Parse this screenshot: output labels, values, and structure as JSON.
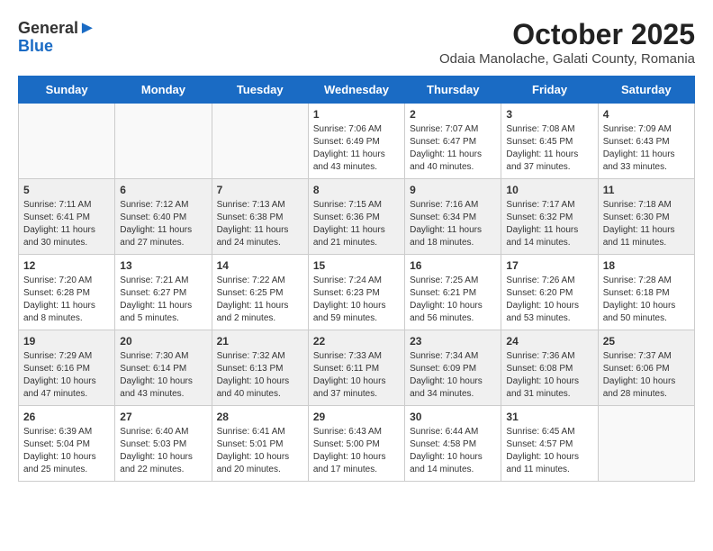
{
  "header": {
    "logo_line1": "General",
    "logo_line2": "Blue",
    "month_title": "October 2025",
    "location": "Odaia Manolache, Galati County, Romania"
  },
  "weekdays": [
    "Sunday",
    "Monday",
    "Tuesday",
    "Wednesday",
    "Thursday",
    "Friday",
    "Saturday"
  ],
  "weeks": [
    [
      {
        "day": "",
        "content": ""
      },
      {
        "day": "",
        "content": ""
      },
      {
        "day": "",
        "content": ""
      },
      {
        "day": "1",
        "content": "Sunrise: 7:06 AM\nSunset: 6:49 PM\nDaylight: 11 hours\nand 43 minutes."
      },
      {
        "day": "2",
        "content": "Sunrise: 7:07 AM\nSunset: 6:47 PM\nDaylight: 11 hours\nand 40 minutes."
      },
      {
        "day": "3",
        "content": "Sunrise: 7:08 AM\nSunset: 6:45 PM\nDaylight: 11 hours\nand 37 minutes."
      },
      {
        "day": "4",
        "content": "Sunrise: 7:09 AM\nSunset: 6:43 PM\nDaylight: 11 hours\nand 33 minutes."
      }
    ],
    [
      {
        "day": "5",
        "content": "Sunrise: 7:11 AM\nSunset: 6:41 PM\nDaylight: 11 hours\nand 30 minutes."
      },
      {
        "day": "6",
        "content": "Sunrise: 7:12 AM\nSunset: 6:40 PM\nDaylight: 11 hours\nand 27 minutes."
      },
      {
        "day": "7",
        "content": "Sunrise: 7:13 AM\nSunset: 6:38 PM\nDaylight: 11 hours\nand 24 minutes."
      },
      {
        "day": "8",
        "content": "Sunrise: 7:15 AM\nSunset: 6:36 PM\nDaylight: 11 hours\nand 21 minutes."
      },
      {
        "day": "9",
        "content": "Sunrise: 7:16 AM\nSunset: 6:34 PM\nDaylight: 11 hours\nand 18 minutes."
      },
      {
        "day": "10",
        "content": "Sunrise: 7:17 AM\nSunset: 6:32 PM\nDaylight: 11 hours\nand 14 minutes."
      },
      {
        "day": "11",
        "content": "Sunrise: 7:18 AM\nSunset: 6:30 PM\nDaylight: 11 hours\nand 11 minutes."
      }
    ],
    [
      {
        "day": "12",
        "content": "Sunrise: 7:20 AM\nSunset: 6:28 PM\nDaylight: 11 hours\nand 8 minutes."
      },
      {
        "day": "13",
        "content": "Sunrise: 7:21 AM\nSunset: 6:27 PM\nDaylight: 11 hours\nand 5 minutes."
      },
      {
        "day": "14",
        "content": "Sunrise: 7:22 AM\nSunset: 6:25 PM\nDaylight: 11 hours\nand 2 minutes."
      },
      {
        "day": "15",
        "content": "Sunrise: 7:24 AM\nSunset: 6:23 PM\nDaylight: 10 hours\nand 59 minutes."
      },
      {
        "day": "16",
        "content": "Sunrise: 7:25 AM\nSunset: 6:21 PM\nDaylight: 10 hours\nand 56 minutes."
      },
      {
        "day": "17",
        "content": "Sunrise: 7:26 AM\nSunset: 6:20 PM\nDaylight: 10 hours\nand 53 minutes."
      },
      {
        "day": "18",
        "content": "Sunrise: 7:28 AM\nSunset: 6:18 PM\nDaylight: 10 hours\nand 50 minutes."
      }
    ],
    [
      {
        "day": "19",
        "content": "Sunrise: 7:29 AM\nSunset: 6:16 PM\nDaylight: 10 hours\nand 47 minutes."
      },
      {
        "day": "20",
        "content": "Sunrise: 7:30 AM\nSunset: 6:14 PM\nDaylight: 10 hours\nand 43 minutes."
      },
      {
        "day": "21",
        "content": "Sunrise: 7:32 AM\nSunset: 6:13 PM\nDaylight: 10 hours\nand 40 minutes."
      },
      {
        "day": "22",
        "content": "Sunrise: 7:33 AM\nSunset: 6:11 PM\nDaylight: 10 hours\nand 37 minutes."
      },
      {
        "day": "23",
        "content": "Sunrise: 7:34 AM\nSunset: 6:09 PM\nDaylight: 10 hours\nand 34 minutes."
      },
      {
        "day": "24",
        "content": "Sunrise: 7:36 AM\nSunset: 6:08 PM\nDaylight: 10 hours\nand 31 minutes."
      },
      {
        "day": "25",
        "content": "Sunrise: 7:37 AM\nSunset: 6:06 PM\nDaylight: 10 hours\nand 28 minutes."
      }
    ],
    [
      {
        "day": "26",
        "content": "Sunrise: 6:39 AM\nSunset: 5:04 PM\nDaylight: 10 hours\nand 25 minutes."
      },
      {
        "day": "27",
        "content": "Sunrise: 6:40 AM\nSunset: 5:03 PM\nDaylight: 10 hours\nand 22 minutes."
      },
      {
        "day": "28",
        "content": "Sunrise: 6:41 AM\nSunset: 5:01 PM\nDaylight: 10 hours\nand 20 minutes."
      },
      {
        "day": "29",
        "content": "Sunrise: 6:43 AM\nSunset: 5:00 PM\nDaylight: 10 hours\nand 17 minutes."
      },
      {
        "day": "30",
        "content": "Sunrise: 6:44 AM\nSunset: 4:58 PM\nDaylight: 10 hours\nand 14 minutes."
      },
      {
        "day": "31",
        "content": "Sunrise: 6:45 AM\nSunset: 4:57 PM\nDaylight: 10 hours\nand 11 minutes."
      },
      {
        "day": "",
        "content": ""
      }
    ]
  ]
}
